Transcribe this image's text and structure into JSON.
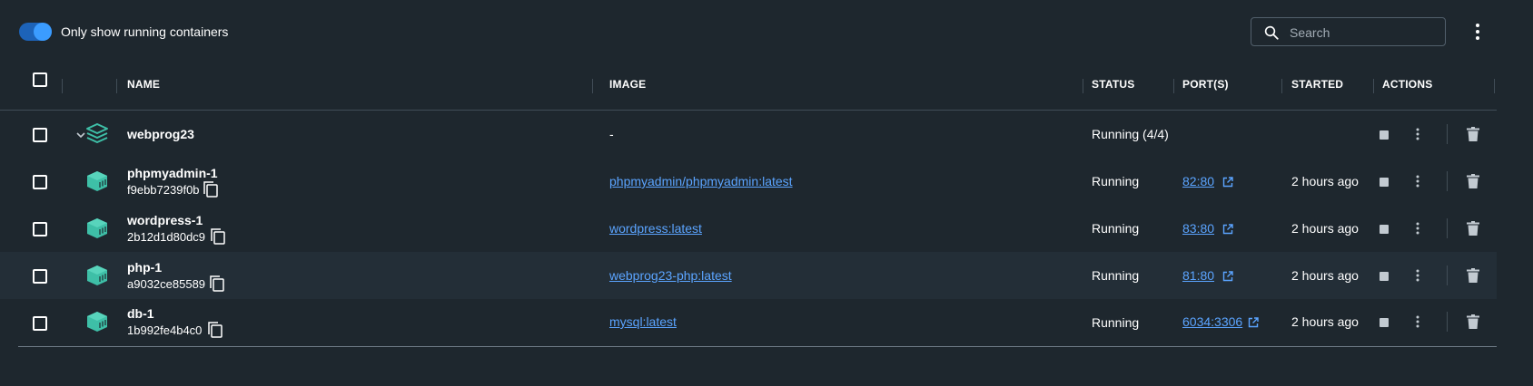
{
  "toolbar": {
    "toggle_label": "Only show running containers",
    "toggle_on": true,
    "search_placeholder": "Search",
    "search_value": ""
  },
  "columns": {
    "name": "NAME",
    "image": "IMAGE",
    "status": "STATUS",
    "ports": "PORT(S)",
    "started": "STARTED",
    "actions": "ACTIONS"
  },
  "group": {
    "name": "webprog23",
    "image": "-",
    "status": "Running (4/4)",
    "expanded": true
  },
  "containers": [
    {
      "name": "phpmyadmin-1",
      "id": "f9ebb7239f0b",
      "image": "phpmyadmin/phpmyadmin:latest",
      "status": "Running",
      "port": "82:80",
      "started": "2 hours ago"
    },
    {
      "name": "wordpress-1",
      "id": "2b12d1d80dc9",
      "image": "wordpress:latest",
      "status": "Running",
      "port": "83:80",
      "started": "2 hours ago"
    },
    {
      "name": "php-1",
      "id": "a9032ce85589",
      "image": "webprog23-php:latest",
      "status": "Running",
      "port": "81:80",
      "started": "2 hours ago"
    },
    {
      "name": "db-1",
      "id": "1b992fe4b4c0",
      "image": "mysql:latest",
      "status": "Running",
      "port": "6034:3306",
      "started": "2 hours ago"
    }
  ],
  "colors": {
    "background": "#1e272e",
    "accent": "#1d63b8",
    "link": "#5ba4ff",
    "container_icon": "#3ebfa7",
    "divider": "#414d57"
  },
  "icons": {
    "search": "search-icon",
    "menu": "more-vertical-icon",
    "stack": "stack-icon",
    "container": "container-icon",
    "copy": "copy-icon",
    "external": "external-link-icon",
    "stop": "stop-icon",
    "delete": "trash-icon",
    "chevron": "chevron-down-icon"
  }
}
